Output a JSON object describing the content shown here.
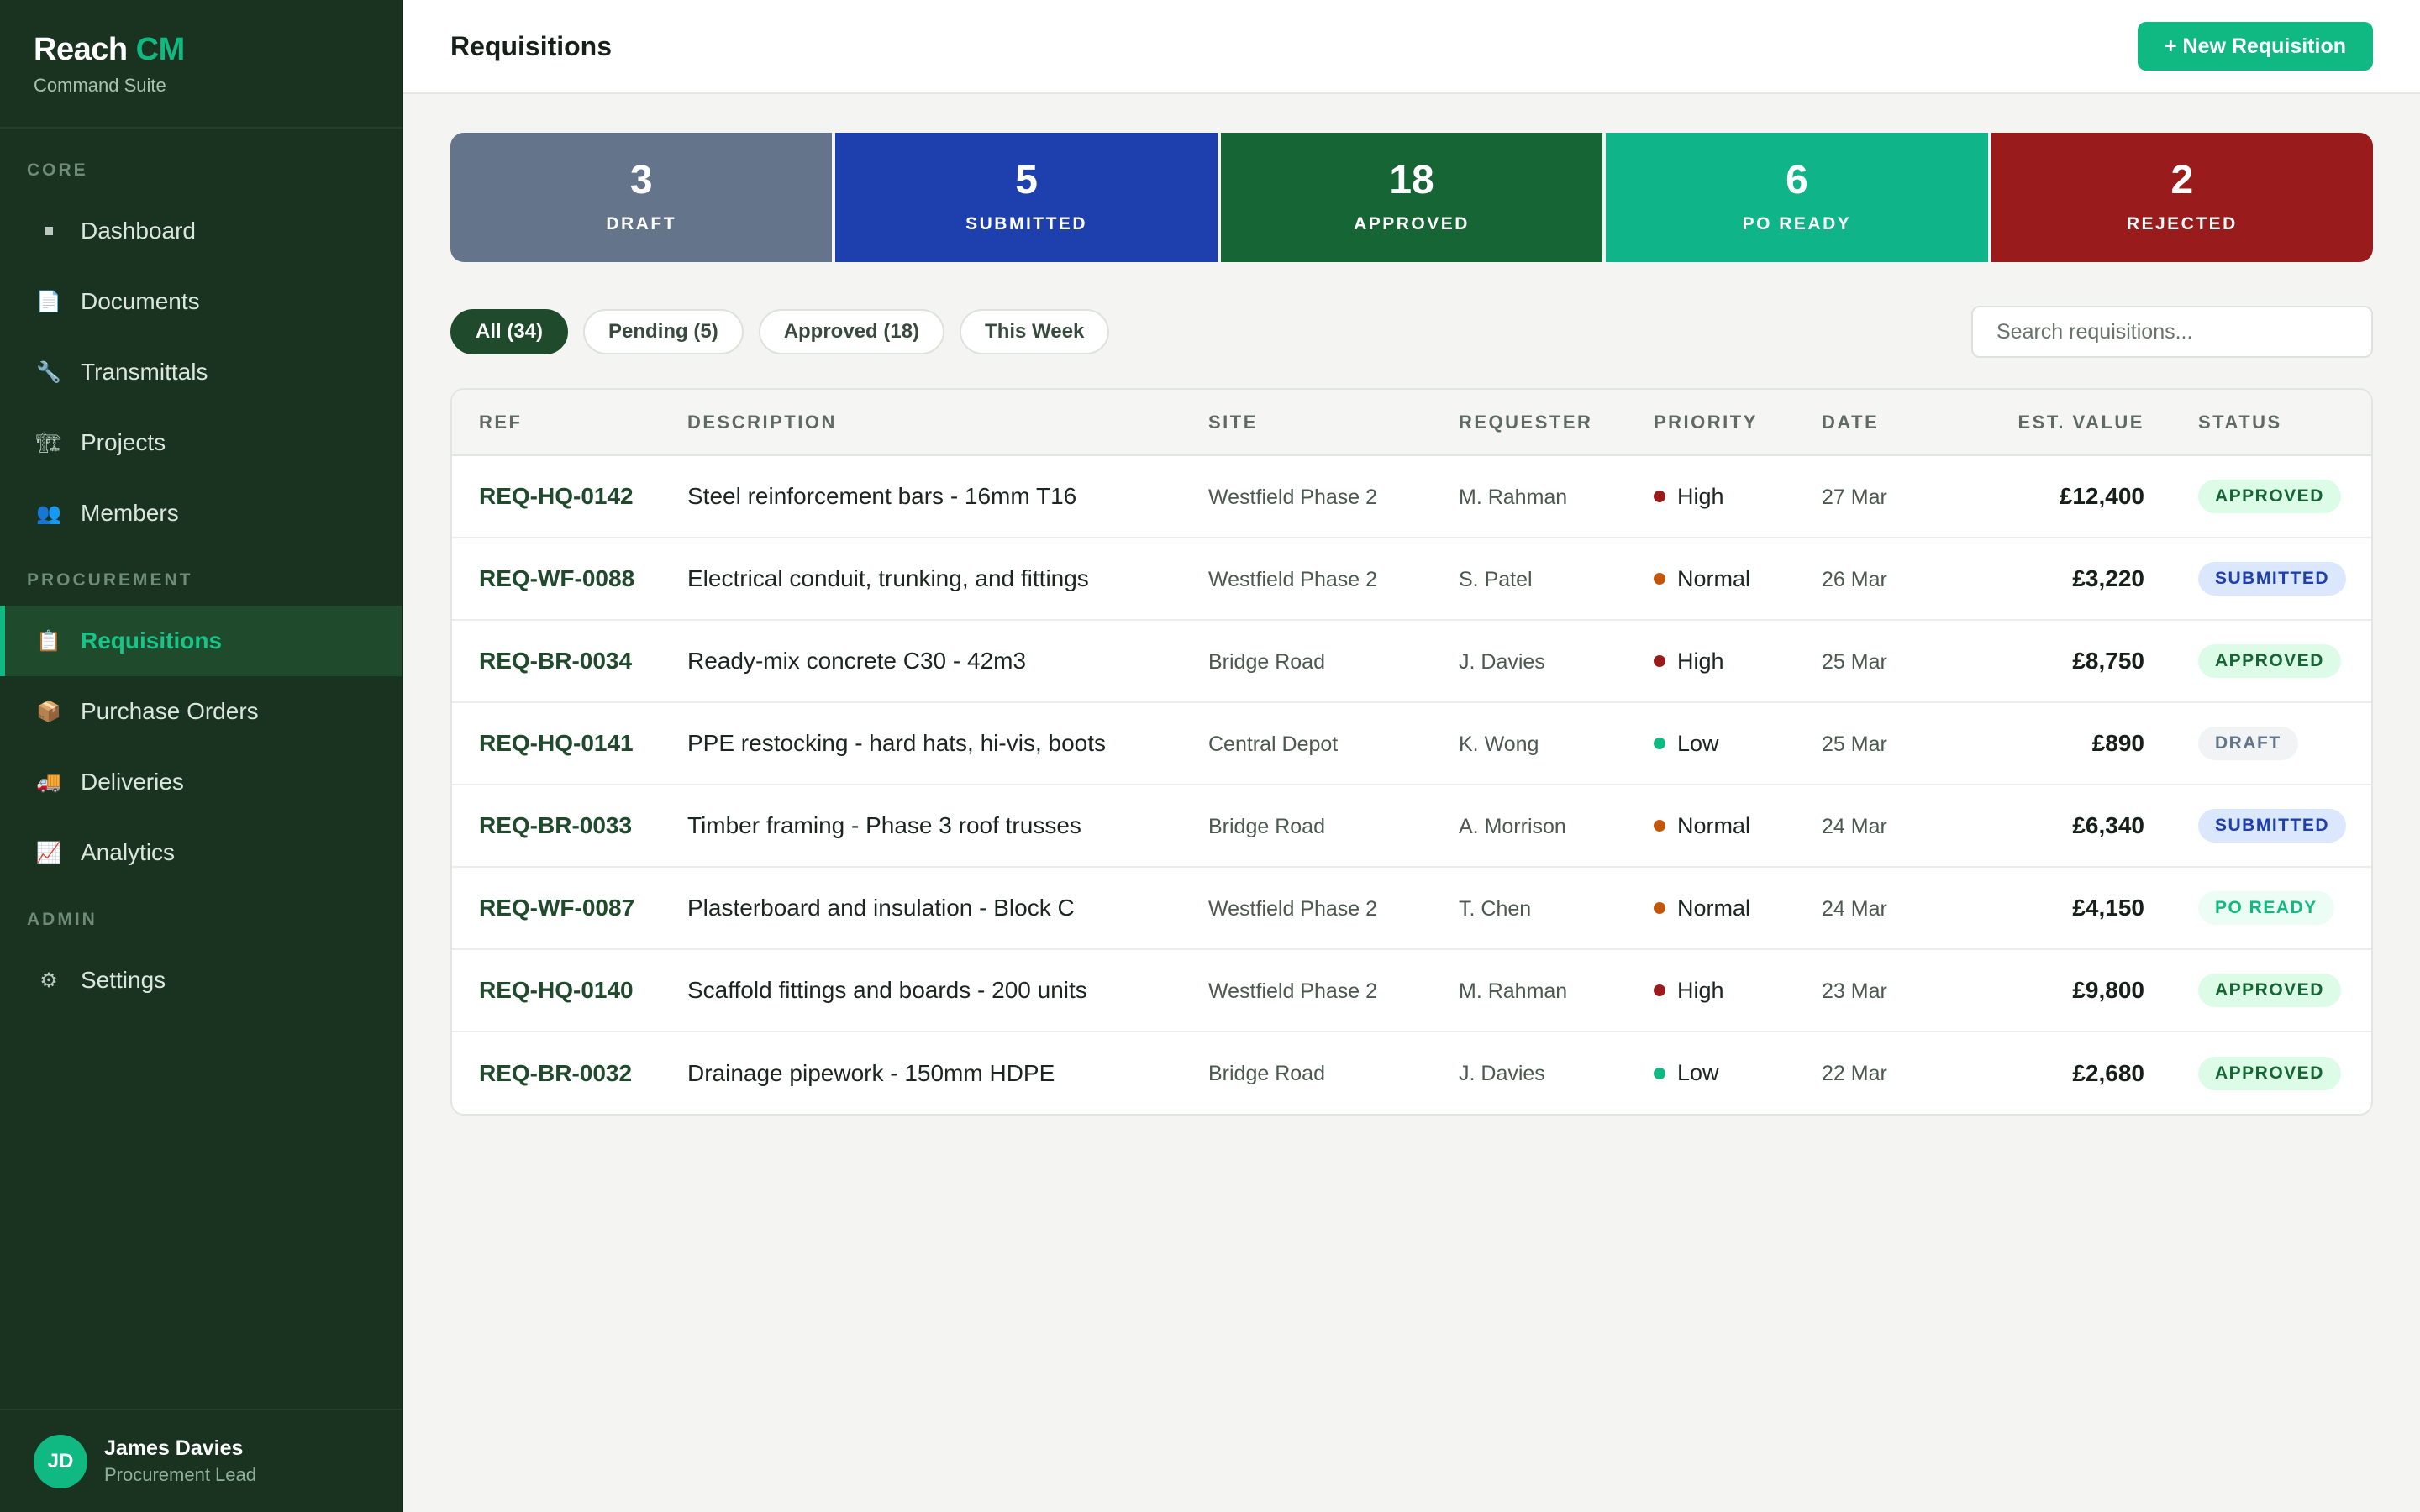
{
  "brand": {
    "name_part1": "Reach",
    "name_part2": "CM",
    "subtitle": "Command Suite"
  },
  "sidebar": {
    "sections": [
      {
        "title": "CORE",
        "items": [
          {
            "label": "Dashboard",
            "icon": "square-icon"
          },
          {
            "label": "Documents",
            "icon": "document-icon"
          },
          {
            "label": "Transmittals",
            "icon": "wrench-icon"
          },
          {
            "label": "Projects",
            "icon": "crane-icon"
          },
          {
            "label": "Members",
            "icon": "people-icon"
          }
        ]
      },
      {
        "title": "PROCUREMENT",
        "items": [
          {
            "label": "Requisitions",
            "icon": "clipboard-icon",
            "active": true
          },
          {
            "label": "Purchase Orders",
            "icon": "package-icon"
          },
          {
            "label": "Deliveries",
            "icon": "truck-icon"
          },
          {
            "label": "Analytics",
            "icon": "chart-icon"
          }
        ]
      },
      {
        "title": "ADMIN",
        "items": [
          {
            "label": "Settings",
            "icon": "gear-icon"
          }
        ]
      }
    ]
  },
  "user": {
    "initials": "JD",
    "name": "James Davies",
    "role": "Procurement Lead"
  },
  "header": {
    "title": "Requisitions",
    "new_button": "+ New Requisition"
  },
  "stats": [
    {
      "value": "3",
      "label": "DRAFT",
      "color": "#64748b"
    },
    {
      "value": "5",
      "label": "SUBMITTED",
      "color": "#1e40af"
    },
    {
      "value": "18",
      "label": "APPROVED",
      "color": "#166534"
    },
    {
      "value": "6",
      "label": "PO READY",
      "color": "#10b489"
    },
    {
      "value": "2",
      "label": "REJECTED",
      "color": "#991b1b"
    }
  ],
  "filters": {
    "chips": [
      {
        "label": "All (34)",
        "active": true
      },
      {
        "label": "Pending (5)"
      },
      {
        "label": "Approved (18)"
      },
      {
        "label": "This Week"
      }
    ],
    "search_placeholder": "Search requisitions..."
  },
  "table": {
    "columns": [
      "REF",
      "DESCRIPTION",
      "SITE",
      "REQUESTER",
      "PRIORITY",
      "DATE",
      "EST. VALUE",
      "STATUS"
    ],
    "rows": [
      {
        "ref": "REQ-HQ-0142",
        "desc": "Steel reinforcement bars - 16mm T16",
        "site": "Westfield Phase 2",
        "requester": "M. Rahman",
        "priority": "High",
        "date": "27 Mar",
        "value": "£12,400",
        "status": "APPROVED"
      },
      {
        "ref": "REQ-WF-0088",
        "desc": "Electrical conduit, trunking, and fittings",
        "site": "Westfield Phase 2",
        "requester": "S. Patel",
        "priority": "Normal",
        "date": "26 Mar",
        "value": "£3,220",
        "status": "SUBMITTED"
      },
      {
        "ref": "REQ-BR-0034",
        "desc": "Ready-mix concrete C30 - 42m3",
        "site": "Bridge Road",
        "requester": "J. Davies",
        "priority": "High",
        "date": "25 Mar",
        "value": "£8,750",
        "status": "APPROVED"
      },
      {
        "ref": "REQ-HQ-0141",
        "desc": "PPE restocking - hard hats, hi-vis, boots",
        "site": "Central Depot",
        "requester": "K. Wong",
        "priority": "Low",
        "date": "25 Mar",
        "value": "£890",
        "status": "DRAFT"
      },
      {
        "ref": "REQ-BR-0033",
        "desc": "Timber framing - Phase 3 roof trusses",
        "site": "Bridge Road",
        "requester": "A. Morrison",
        "priority": "Normal",
        "date": "24 Mar",
        "value": "£6,340",
        "status": "SUBMITTED"
      },
      {
        "ref": "REQ-WF-0087",
        "desc": "Plasterboard and insulation - Block C",
        "site": "Westfield Phase 2",
        "requester": "T. Chen",
        "priority": "Normal",
        "date": "24 Mar",
        "value": "£4,150",
        "status": "PO READY"
      },
      {
        "ref": "REQ-HQ-0140",
        "desc": "Scaffold fittings and boards - 200 units",
        "site": "Westfield Phase 2",
        "requester": "M. Rahman",
        "priority": "High",
        "date": "23 Mar",
        "value": "£9,800",
        "status": "APPROVED"
      },
      {
        "ref": "REQ-BR-0032",
        "desc": "Drainage pipework - 150mm HDPE",
        "site": "Bridge Road",
        "requester": "J. Davies",
        "priority": "Low",
        "date": "22 Mar",
        "value": "£2,680",
        "status": "APPROVED"
      }
    ]
  },
  "priority_colors": {
    "High": "#991b1b",
    "Normal": "#c2570c",
    "Low": "#10b981"
  },
  "status_styles": {
    "APPROVED": {
      "bg": "#dcfce7",
      "fg": "#166534"
    },
    "SUBMITTED": {
      "bg": "#dbe7fc",
      "fg": "#1e40af"
    },
    "DRAFT": {
      "bg": "#f1f3f5",
      "fg": "#64748b"
    },
    "PO READY": {
      "bg": "#ecfdf5",
      "fg": "#10b981"
    }
  }
}
